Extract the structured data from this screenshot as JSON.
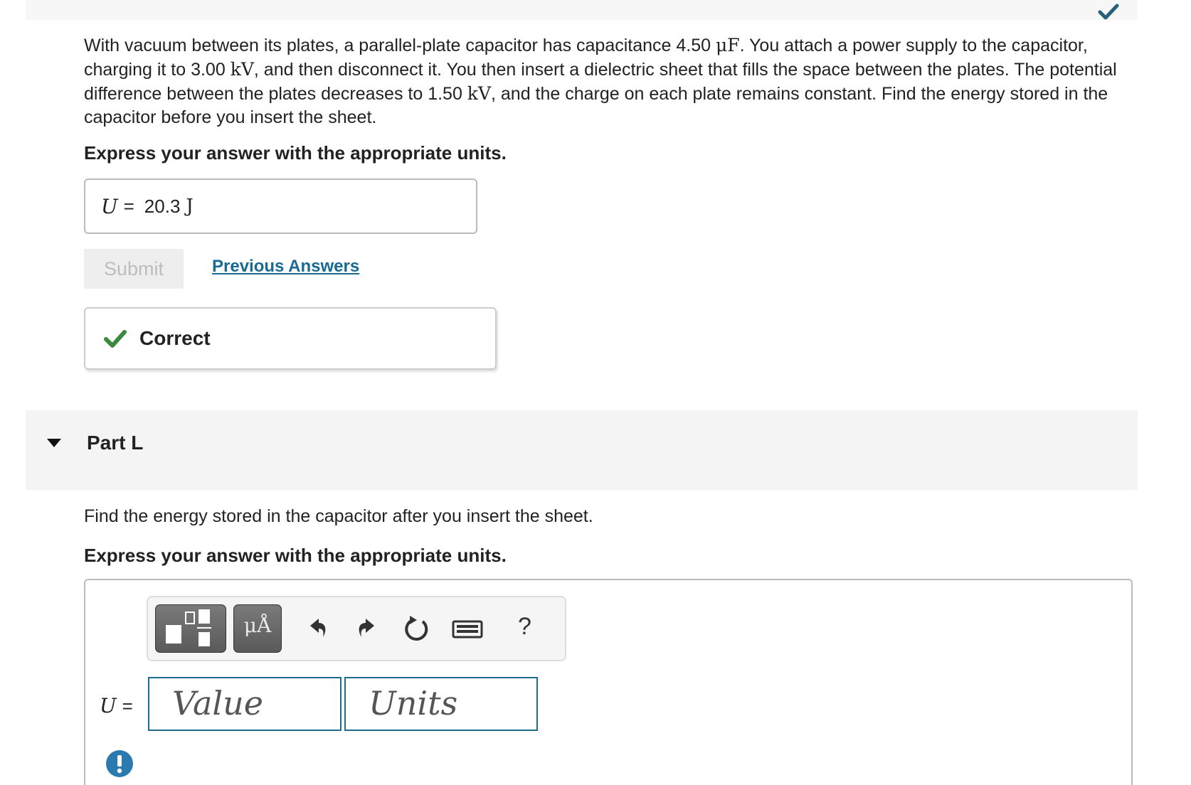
{
  "problem": {
    "part1": "With vacuum between its plates, a parallel-plate capacitor has capacitance 4.50 ",
    "unit_capacitance": "μF",
    "part2": ". You attach a power supply to the capacitor, charging it to 3.00 ",
    "unit_kv1": "kV",
    "part3": ", and then disconnect it. You then insert a dielectric sheet that fills the space between the plates. The potential difference between the plates decreases to 1.50 ",
    "unit_kv2": "kV",
    "part4": ", and the charge on each plate remains constant. Find the energy stored in the capacitor before you insert the sheet."
  },
  "instruction": "Express your answer with the appropriate units.",
  "answer": {
    "label": "U",
    "equals": "=",
    "value": "20.3",
    "unit": "J"
  },
  "buttons": {
    "submit": "Submit",
    "previous_answers": "Previous Answers"
  },
  "feedback": {
    "text": "Correct"
  },
  "part_l": {
    "title": "Part L",
    "question": "Find the energy stored in the capacitor after you insert the sheet.",
    "instruction": "Express your answer with the appropriate units.",
    "toolbar": {
      "mu_label": "μÅ",
      "help": "?",
      "icons": [
        "templates-icon",
        "symbols-icon",
        "undo-icon",
        "redo-icon",
        "reset-icon",
        "keyboard-icon",
        "help-icon"
      ]
    },
    "input": {
      "label": "U",
      "equals": "=",
      "value_placeholder": "Value",
      "units_placeholder": "Units"
    }
  },
  "colors": {
    "check_green": "#3a8a3f",
    "link_blue": "#1a6a92",
    "field_border": "#1f6a8f",
    "alert_blue": "#2a7ab0"
  }
}
